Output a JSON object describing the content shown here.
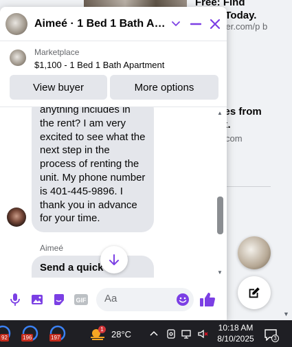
{
  "background": {
    "ad1_title": "Free: Find Great Today.",
    "ad1_link": "iter.com/p b",
    "ad2_title": "ales from ox.",
    "ad2_link": "com"
  },
  "chat": {
    "title": "Aimeé · 1 Bed 1 Bath Apart…",
    "listing": {
      "source": "Marketplace",
      "title": "$1,100 - 1 Bed 1 Bath Apartment",
      "view_buyer": "View buyer",
      "more_options": "More options"
    },
    "messages": {
      "incoming_text": "anything includes in the rent? I am very excited to see what the next step in the process of renting the unit. My phone number is 401-445-9896. I thank you in advance for your time.",
      "sender_name": "Aimeé",
      "outgoing_text": "Send a quick response"
    },
    "composer": {
      "placeholder": "Aa"
    }
  },
  "taskbar": {
    "badges": [
      "92",
      "196",
      "197"
    ],
    "weather_badge": "1",
    "temperature": "28°C",
    "time": "10:18 AM",
    "date": "8/10/2025",
    "notification_count": "3"
  },
  "colors": {
    "accent": "#7b3fe4",
    "messenger_blue": "#0084ff",
    "bubble_gray": "#e4e6eb",
    "taskbar": "#1f1f24"
  }
}
